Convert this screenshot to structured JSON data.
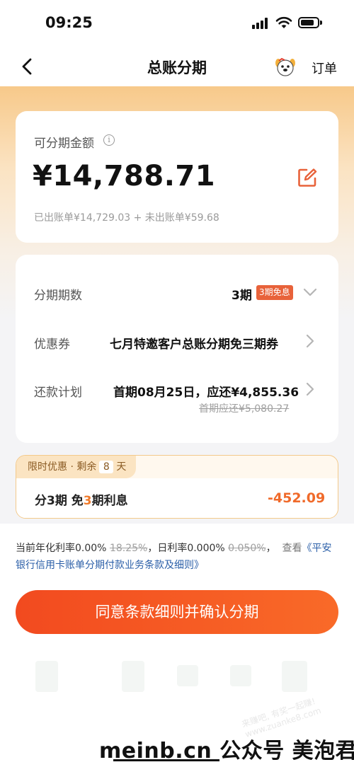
{
  "status_bar": {
    "time": "09:25"
  },
  "nav": {
    "title": "总账分期",
    "orders_label": "订单"
  },
  "amount_card": {
    "label": "可分期金额",
    "info_glyph": "i",
    "amount": "¥14,788.71",
    "breakdown": "已出账单¥14,729.03 + 未出账单¥59.68"
  },
  "details": {
    "periods": {
      "label": "分期期数",
      "value": "3期",
      "badge": "3期免息"
    },
    "coupon": {
      "label": "优惠券",
      "value": "七月特邀客户总账分期免三期券"
    },
    "plan": {
      "label": "还款计划",
      "value": "首期08月25日，应还¥4,855.36",
      "original": "首期应还¥5,080.27"
    }
  },
  "promo": {
    "tag_prefix": "限时优惠 · 剩余",
    "days": "8",
    "tag_suffix": "天",
    "text_a": "分3期 免",
    "text_hl": "3",
    "text_b": "期利息",
    "amount": "-452.09"
  },
  "terms": {
    "rate_label": "当前年化利率0.00%",
    "rate_orig": "18.25%",
    "daily_label": "，日利率0.000%",
    "daily_orig": "0.050%",
    "comma": "，",
    "view": "查看",
    "link": "《平安银行信用卡账单分期付款业务条款及细则》"
  },
  "confirm_button": "同意条款细则并确认分期",
  "footer": "meinb.cn  公众号 美泡君",
  "watermark": "来赚吧, 有奖一起赚! www.zuanke8.com",
  "colors": {
    "accent": "#f24a1f",
    "badge": "#e8623a",
    "link": "#2b5fa8",
    "promo_amount": "#f06a2a"
  }
}
